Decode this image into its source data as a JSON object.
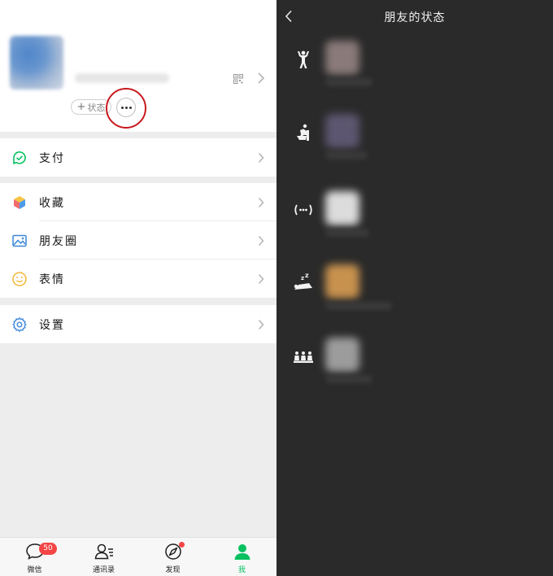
{
  "left": {
    "profile": {
      "status_button_label": "状态",
      "status_button_plus": "+"
    },
    "menu": {
      "pay": "支付",
      "favorites": "收藏",
      "moments": "朋友圈",
      "stickers": "表情",
      "settings": "设置"
    },
    "tabbar": {
      "tabs": [
        {
          "label": "微信",
          "icon": "chat-bubble-icon",
          "badge": "50"
        },
        {
          "label": "通讯录",
          "icon": "contacts-icon"
        },
        {
          "label": "发现",
          "icon": "compass-icon"
        },
        {
          "label": "我",
          "icon": "person-icon",
          "active": true
        }
      ]
    }
  },
  "right": {
    "header": {
      "title": "朋友的状态"
    },
    "statuses": [
      {
        "icon": "weightlifting-icon"
      },
      {
        "icon": "toilet-icon"
      },
      {
        "icon": "signal-waves-icon"
      },
      {
        "icon": "sleeping-icon"
      },
      {
        "icon": "group-meeting-icon"
      }
    ]
  },
  "colors": {
    "accent_green": "#07c160",
    "badge_red": "#f54545",
    "highlight_ring": "#c8191e",
    "dark_bg": "#2a2a2a"
  }
}
